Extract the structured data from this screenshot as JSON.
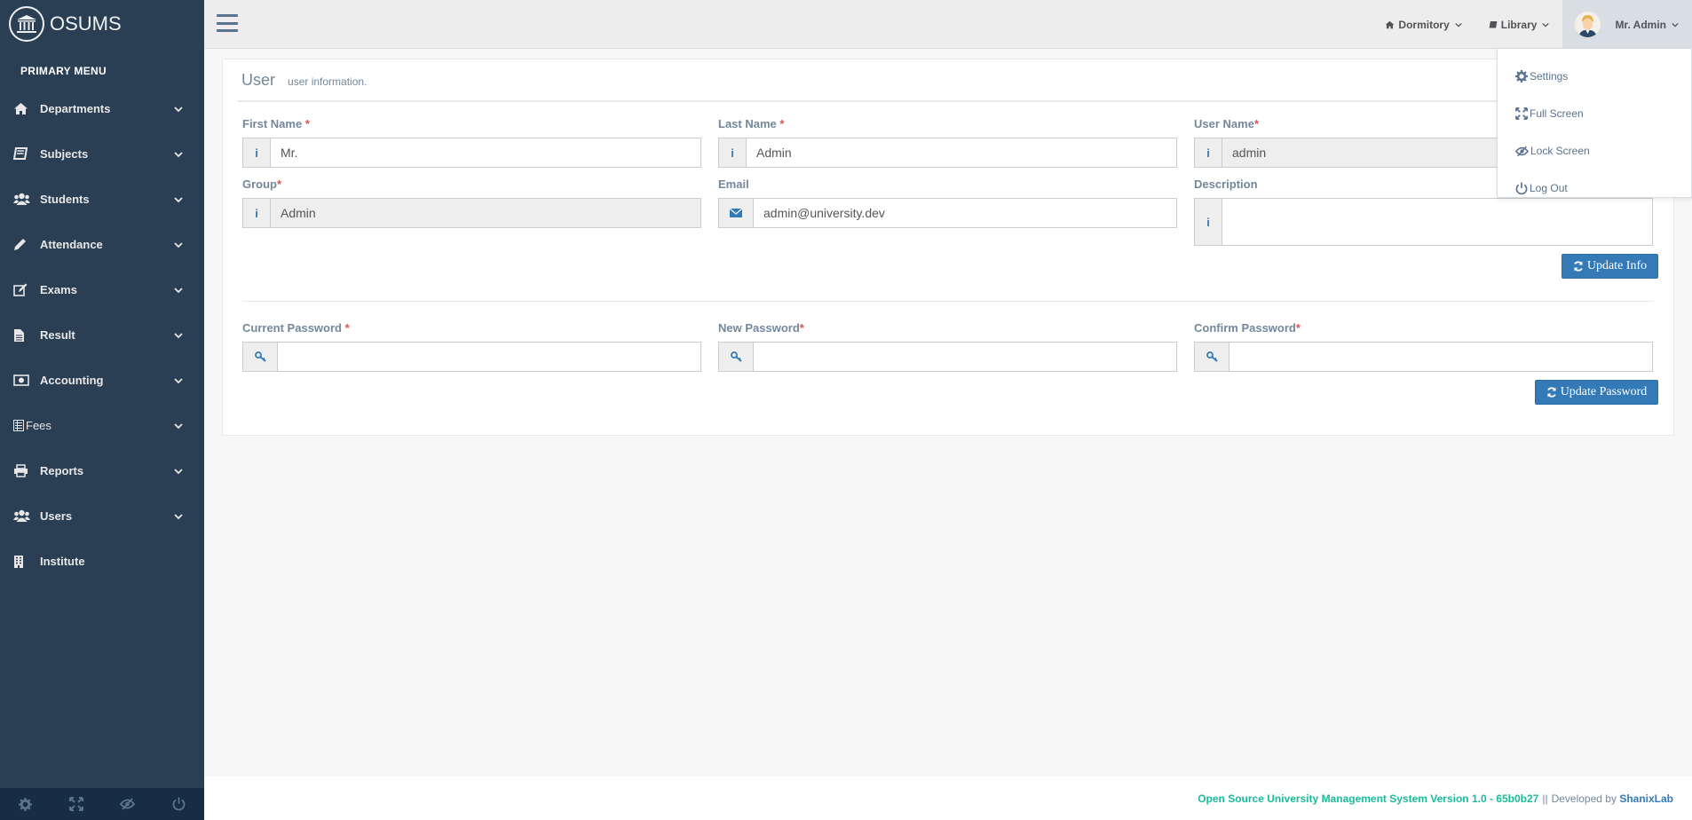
{
  "app": {
    "brand": "OSUMS"
  },
  "sidebar": {
    "header": "PRIMARY MENU",
    "items": [
      {
        "label": "Departments",
        "icon": "home-icon",
        "expandable": true
      },
      {
        "label": "Subjects",
        "icon": "book-icon",
        "expandable": true
      },
      {
        "label": "Students",
        "icon": "users-icon",
        "expandable": true
      },
      {
        "label": "Attendance",
        "icon": "pencil-icon",
        "expandable": true
      },
      {
        "label": "Exams",
        "icon": "edit-icon",
        "expandable": true
      },
      {
        "label": "Result",
        "icon": "file-icon",
        "expandable": true
      },
      {
        "label": "Accounting",
        "icon": "money-icon",
        "expandable": true
      },
      {
        "label": "Fees",
        "icon": "list-icon",
        "expandable": true
      },
      {
        "label": "Reports",
        "icon": "print-icon",
        "expandable": true
      },
      {
        "label": "Users",
        "icon": "users-icon",
        "expandable": true
      },
      {
        "label": "Institute",
        "icon": "building-icon",
        "expandable": false
      }
    ],
    "footer_icons": [
      "gear-icon",
      "fullscreen-icon",
      "eye-slash-icon",
      "power-icon"
    ]
  },
  "topnav": {
    "dormitory": "Dormitory",
    "library": "Library",
    "user": "Mr. Admin"
  },
  "user_menu": {
    "settings": "Settings",
    "fullscreen": "Full Screen",
    "lock": "Lock Screen",
    "logout": "Log Out"
  },
  "panel": {
    "title": "User",
    "subtitle": "user information.",
    "first_name": {
      "label": "First Name",
      "value": "Mr."
    },
    "last_name": {
      "label": "Last Name",
      "value": "Admin"
    },
    "user_name": {
      "label": "User Name",
      "value": "admin"
    },
    "group": {
      "label": "Group",
      "value": "Admin"
    },
    "email": {
      "label": "Email",
      "value": "admin@university.dev"
    },
    "description": {
      "label": "Description",
      "value": ""
    },
    "update_info": "Update Info",
    "current_password": {
      "label": "Current Password",
      "value": ""
    },
    "new_password": {
      "label": "New Password",
      "value": ""
    },
    "confirm_password": {
      "label": "Confirm Password",
      "value": ""
    },
    "update_password": "Update Password",
    "required_mark": "*"
  },
  "footer": {
    "system": "Open Source University Management System Version 1.0 - 65b0b27",
    "separator": "||",
    "developed_by": "Developed by",
    "developer": "ShanixLab"
  },
  "colors": {
    "sidebar_bg": "#2A3F54",
    "accent_blue": "#337AB7",
    "footer_green": "#1ABB9C",
    "required_red": "#D9534F"
  }
}
